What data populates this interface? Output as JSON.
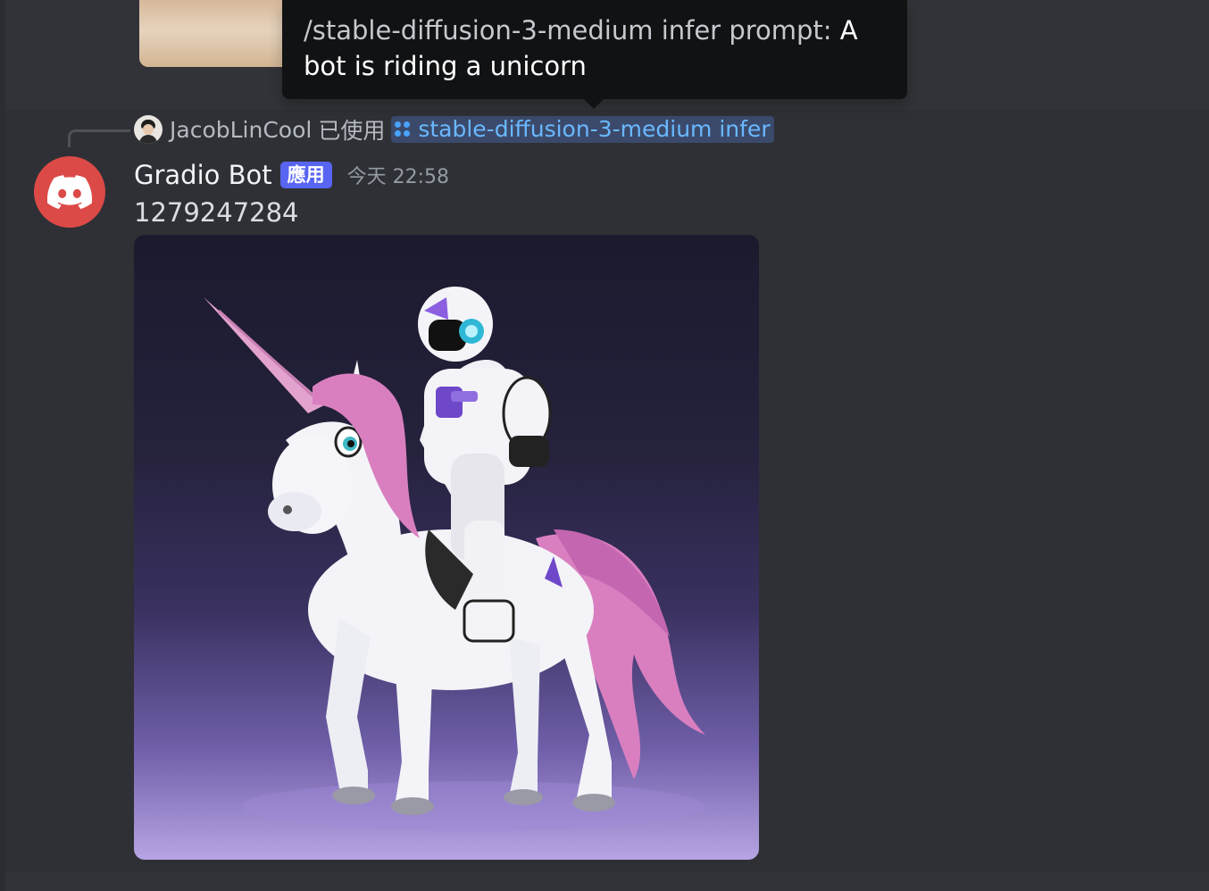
{
  "colors": {
    "background": "#313338",
    "hover_background": "#2e3035",
    "tooltip_background": "#111214",
    "app_badge": "#5865f2",
    "avatar_red": "#dc4a47",
    "command_link": "#6ab8ff"
  },
  "tooltip": {
    "command_text": "/stable-diffusion-3-medium infer prompt: ",
    "value_text": "A bot is riding a unicorn"
  },
  "reference": {
    "avatar_icon": "user-avatar",
    "user": "JacobLinCool",
    "used_label": "已使用",
    "command_icon": "app-command-icon",
    "command": "stable-diffusion-3-medium infer"
  },
  "message": {
    "avatar_icon": "discord-logo-icon",
    "username": "Gradio Bot",
    "badge": "應用",
    "timestamp": "今天 22:58",
    "content": "1279247284",
    "attachment_subject": "robot riding unicorn image"
  }
}
